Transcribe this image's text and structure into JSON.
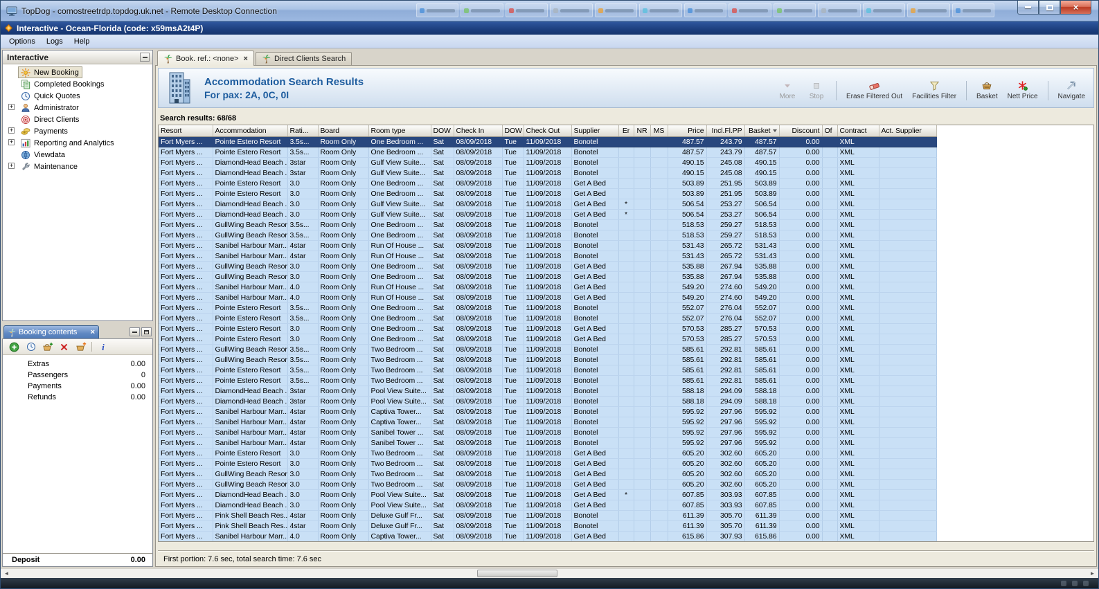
{
  "rdp": {
    "title": "TopDog - comostreetrdp.topdog.uk.net - Remote Desktop Connection"
  },
  "app": {
    "title": "Interactive - Ocean-Florida (code: x59msA2t4P)",
    "menus": [
      "Options",
      "Logs",
      "Help"
    ]
  },
  "sidebar": {
    "title": "Interactive",
    "items": [
      {
        "label": "New Booking",
        "icon": "sun-icon",
        "selected": true,
        "expandable": false
      },
      {
        "label": "Completed Bookings",
        "icon": "documents-icon",
        "selected": false,
        "expandable": false
      },
      {
        "label": "Quick Quotes",
        "icon": "clock-icon",
        "selected": false,
        "expandable": false
      },
      {
        "label": "Administrator",
        "icon": "person-icon",
        "selected": false,
        "expandable": true
      },
      {
        "label": "Direct Clients",
        "icon": "target-icon",
        "selected": false,
        "expandable": false
      },
      {
        "label": "Payments",
        "icon": "coins-icon",
        "selected": false,
        "expandable": true
      },
      {
        "label": "Reporting and Analytics",
        "icon": "chart-icon",
        "selected": false,
        "expandable": true
      },
      {
        "label": "Viewdata",
        "icon": "globe-icon",
        "selected": false,
        "expandable": false
      },
      {
        "label": "Maintenance",
        "icon": "wrench-icon",
        "selected": false,
        "expandable": true
      }
    ]
  },
  "booking_contents": {
    "title": "Booking contents",
    "toolbar_icons": [
      "add-icon",
      "clock-icon",
      "cart-add-icon",
      "delete-icon",
      "cart-up-icon",
      "info-icon"
    ],
    "rows": [
      {
        "label": "Extras",
        "value": "0.00"
      },
      {
        "label": "Passengers",
        "value": "0"
      },
      {
        "label": "Payments",
        "value": "0.00"
      },
      {
        "label": "Refunds",
        "value": "0.00"
      }
    ],
    "footer": {
      "label": "Deposit",
      "value": "0.00"
    }
  },
  "tabs": [
    {
      "label": "Book. ref.: <none>",
      "icon": "palm-icon",
      "active": true,
      "closable": true
    },
    {
      "label": "Direct Clients Search",
      "icon": "palm-icon",
      "active": false,
      "closable": false
    }
  ],
  "results_header": {
    "title": "Accommodation Search Results",
    "subtitle": "For pax: 2A, 0C, 0I"
  },
  "toolbar": {
    "buttons": [
      {
        "label": "More",
        "icon": "more-icon",
        "disabled": true,
        "sep_after": false
      },
      {
        "label": "Stop",
        "icon": "stop-icon",
        "disabled": true,
        "sep_after": true
      },
      {
        "label": "Erase Filtered Out",
        "icon": "eraser-icon",
        "disabled": false,
        "sep_after": false
      },
      {
        "label": "Facilities Filter",
        "icon": "filter-icon",
        "disabled": false,
        "sep_after": true
      },
      {
        "label": "Basket",
        "icon": "basket-icon",
        "disabled": false,
        "sep_after": false
      },
      {
        "label": "Nett Price",
        "icon": "price-icon",
        "disabled": false,
        "sep_after": true
      },
      {
        "label": "Navigate",
        "icon": "navigate-icon",
        "disabled": false,
        "sep_after": false
      }
    ]
  },
  "results": {
    "summary": "Search results: 68/68",
    "status": "First portion: 7.6 sec, total search time: 7.6 sec",
    "sort_column": "Basket",
    "columns": [
      "Resort",
      "Accommodation",
      "Rati...",
      "Board",
      "Room type",
      "DOW",
      "Check In",
      "DOW",
      "Check Out",
      "Supplier",
      "Er",
      "NR",
      "MS",
      "Price",
      "Incl.Fl.PP",
      "Basket",
      "Discount",
      "Of",
      "Contract",
      "Act. Supplier"
    ],
    "row_constants": {
      "resort": "Fort Myers ...",
      "board": "Room Only",
      "dow_in": "Sat",
      "check_in": "08/09/2018",
      "dow_out": "Tue",
      "check_out": "11/09/2018",
      "discount": "0.00",
      "contract": "XML"
    },
    "rows": [
      {
        "acc": "Pointe Estero Resort",
        "rating": "3.5s...",
        "room": "One Bedroom ...",
        "supplier": "Bonotel",
        "er": "",
        "price": "487.57",
        "incl": "243.79",
        "basket": "487.57",
        "selected": true
      },
      {
        "acc": "Pointe Estero Resort",
        "rating": "3.5s...",
        "room": "One Bedroom ...",
        "supplier": "Bonotel",
        "er": "",
        "price": "487.57",
        "incl": "243.79",
        "basket": "487.57"
      },
      {
        "acc": "DiamondHead Beach ...",
        "rating": "3star",
        "room": "Gulf View Suite...",
        "supplier": "Bonotel",
        "er": "",
        "price": "490.15",
        "incl": "245.08",
        "basket": "490.15"
      },
      {
        "acc": "DiamondHead Beach ...",
        "rating": "3star",
        "room": "Gulf View Suite...",
        "supplier": "Bonotel",
        "er": "",
        "price": "490.15",
        "incl": "245.08",
        "basket": "490.15"
      },
      {
        "acc": "Pointe Estero Resort",
        "rating": "3.0",
        "room": "One Bedroom ...",
        "supplier": "Get A Bed",
        "er": "",
        "price": "503.89",
        "incl": "251.95",
        "basket": "503.89"
      },
      {
        "acc": "Pointe Estero Resort",
        "rating": "3.0",
        "room": "One Bedroom ...",
        "supplier": "Get A Bed",
        "er": "",
        "price": "503.89",
        "incl": "251.95",
        "basket": "503.89"
      },
      {
        "acc": "DiamondHead Beach ...",
        "rating": "3.0",
        "room": "Gulf View Suite...",
        "supplier": "Get A Bed",
        "er": "*",
        "price": "506.54",
        "incl": "253.27",
        "basket": "506.54"
      },
      {
        "acc": "DiamondHead Beach ...",
        "rating": "3.0",
        "room": "Gulf View Suite...",
        "supplier": "Get A Bed",
        "er": "*",
        "price": "506.54",
        "incl": "253.27",
        "basket": "506.54"
      },
      {
        "acc": "GullWing Beach Resort",
        "rating": "3.5s...",
        "room": "One Bedroom ...",
        "supplier": "Bonotel",
        "er": "",
        "price": "518.53",
        "incl": "259.27",
        "basket": "518.53"
      },
      {
        "acc": "GullWing Beach Resort",
        "rating": "3.5s...",
        "room": "One Bedroom ...",
        "supplier": "Bonotel",
        "er": "",
        "price": "518.53",
        "incl": "259.27",
        "basket": "518.53"
      },
      {
        "acc": "Sanibel Harbour Marr...",
        "rating": "4star",
        "room": "Run Of House ...",
        "supplier": "Bonotel",
        "er": "",
        "price": "531.43",
        "incl": "265.72",
        "basket": "531.43"
      },
      {
        "acc": "Sanibel Harbour Marr...",
        "rating": "4star",
        "room": "Run Of House ...",
        "supplier": "Bonotel",
        "er": "",
        "price": "531.43",
        "incl": "265.72",
        "basket": "531.43"
      },
      {
        "acc": "GullWing Beach Resort",
        "rating": "3.0",
        "room": "One Bedroom ...",
        "supplier": "Get A Bed",
        "er": "",
        "price": "535.88",
        "incl": "267.94",
        "basket": "535.88"
      },
      {
        "acc": "GullWing Beach Resort",
        "rating": "3.0",
        "room": "One Bedroom ...",
        "supplier": "Get A Bed",
        "er": "",
        "price": "535.88",
        "incl": "267.94",
        "basket": "535.88"
      },
      {
        "acc": "Sanibel Harbour Marr...",
        "rating": "4.0",
        "room": "Run Of House ...",
        "supplier": "Get A Bed",
        "er": "",
        "price": "549.20",
        "incl": "274.60",
        "basket": "549.20"
      },
      {
        "acc": "Sanibel Harbour Marr...",
        "rating": "4.0",
        "room": "Run Of House ...",
        "supplier": "Get A Bed",
        "er": "",
        "price": "549.20",
        "incl": "274.60",
        "basket": "549.20"
      },
      {
        "acc": "Pointe Estero Resort",
        "rating": "3.5s...",
        "room": "One Bedroom ...",
        "supplier": "Bonotel",
        "er": "",
        "price": "552.07",
        "incl": "276.04",
        "basket": "552.07"
      },
      {
        "acc": "Pointe Estero Resort",
        "rating": "3.5s...",
        "room": "One Bedroom ...",
        "supplier": "Bonotel",
        "er": "",
        "price": "552.07",
        "incl": "276.04",
        "basket": "552.07"
      },
      {
        "acc": "Pointe Estero Resort",
        "rating": "3.0",
        "room": "One Bedroom ...",
        "supplier": "Get A Bed",
        "er": "",
        "price": "570.53",
        "incl": "285.27",
        "basket": "570.53"
      },
      {
        "acc": "Pointe Estero Resort",
        "rating": "3.0",
        "room": "One Bedroom ...",
        "supplier": "Get A Bed",
        "er": "",
        "price": "570.53",
        "incl": "285.27",
        "basket": "570.53"
      },
      {
        "acc": "GullWing Beach Resort",
        "rating": "3.5s...",
        "room": "Two Bedroom ...",
        "supplier": "Bonotel",
        "er": "",
        "price": "585.61",
        "incl": "292.81",
        "basket": "585.61"
      },
      {
        "acc": "GullWing Beach Resort",
        "rating": "3.5s...",
        "room": "Two Bedroom ...",
        "supplier": "Bonotel",
        "er": "",
        "price": "585.61",
        "incl": "292.81",
        "basket": "585.61"
      },
      {
        "acc": "Pointe Estero Resort",
        "rating": "3.5s...",
        "room": "Two Bedroom ...",
        "supplier": "Bonotel",
        "er": "",
        "price": "585.61",
        "incl": "292.81",
        "basket": "585.61"
      },
      {
        "acc": "Pointe Estero Resort",
        "rating": "3.5s...",
        "room": "Two Bedroom ...",
        "supplier": "Bonotel",
        "er": "",
        "price": "585.61",
        "incl": "292.81",
        "basket": "585.61"
      },
      {
        "acc": "DiamondHead Beach ...",
        "rating": "3star",
        "room": "Pool View Suite...",
        "supplier": "Bonotel",
        "er": "",
        "price": "588.18",
        "incl": "294.09",
        "basket": "588.18"
      },
      {
        "acc": "DiamondHead Beach ...",
        "rating": "3star",
        "room": "Pool View Suite...",
        "supplier": "Bonotel",
        "er": "",
        "price": "588.18",
        "incl": "294.09",
        "basket": "588.18"
      },
      {
        "acc": "Sanibel Harbour Marr...",
        "rating": "4star",
        "room": "Captiva Tower...",
        "supplier": "Bonotel",
        "er": "",
        "price": "595.92",
        "incl": "297.96",
        "basket": "595.92"
      },
      {
        "acc": "Sanibel Harbour Marr...",
        "rating": "4star",
        "room": "Captiva Tower...",
        "supplier": "Bonotel",
        "er": "",
        "price": "595.92",
        "incl": "297.96",
        "basket": "595.92"
      },
      {
        "acc": "Sanibel Harbour Marr...",
        "rating": "4star",
        "room": "Sanibel Tower ...",
        "supplier": "Bonotel",
        "er": "",
        "price": "595.92",
        "incl": "297.96",
        "basket": "595.92"
      },
      {
        "acc": "Sanibel Harbour Marr...",
        "rating": "4star",
        "room": "Sanibel Tower ...",
        "supplier": "Bonotel",
        "er": "",
        "price": "595.92",
        "incl": "297.96",
        "basket": "595.92"
      },
      {
        "acc": "Pointe Estero Resort",
        "rating": "3.0",
        "room": "Two Bedroom ...",
        "supplier": "Get A Bed",
        "er": "",
        "price": "605.20",
        "incl": "302.60",
        "basket": "605.20"
      },
      {
        "acc": "Pointe Estero Resort",
        "rating": "3.0",
        "room": "Two Bedroom ...",
        "supplier": "Get A Bed",
        "er": "",
        "price": "605.20",
        "incl": "302.60",
        "basket": "605.20"
      },
      {
        "acc": "GullWing Beach Resort",
        "rating": "3.0",
        "room": "Two Bedroom ...",
        "supplier": "Get A Bed",
        "er": "",
        "price": "605.20",
        "incl": "302.60",
        "basket": "605.20"
      },
      {
        "acc": "GullWing Beach Resort",
        "rating": "3.0",
        "room": "Two Bedroom ...",
        "supplier": "Get A Bed",
        "er": "",
        "price": "605.20",
        "incl": "302.60",
        "basket": "605.20"
      },
      {
        "acc": "DiamondHead Beach ...",
        "rating": "3.0",
        "room": "Pool View Suite...",
        "supplier": "Get A Bed",
        "er": "*",
        "price": "607.85",
        "incl": "303.93",
        "basket": "607.85"
      },
      {
        "acc": "DiamondHead Beach ...",
        "rating": "3.0",
        "room": "Pool View Suite...",
        "supplier": "Get A Bed",
        "er": "",
        "price": "607.85",
        "incl": "303.93",
        "basket": "607.85"
      },
      {
        "acc": "Pink Shell Beach Res...",
        "rating": "4star",
        "room": "Deluxe Gulf Fr...",
        "supplier": "Bonotel",
        "er": "",
        "price": "611.39",
        "incl": "305.70",
        "basket": "611.39"
      },
      {
        "acc": "Pink Shell Beach Res...",
        "rating": "4star",
        "room": "Deluxe Gulf Fr...",
        "supplier": "Bonotel",
        "er": "",
        "price": "611.39",
        "incl": "305.70",
        "basket": "611.39"
      },
      {
        "acc": "Sanibel Harbour Marr...",
        "rating": "4.0",
        "room": "Captiva Tower...",
        "supplier": "Get A Bed",
        "er": "",
        "price": "615.86",
        "incl": "307.93",
        "basket": "615.86"
      }
    ]
  }
}
